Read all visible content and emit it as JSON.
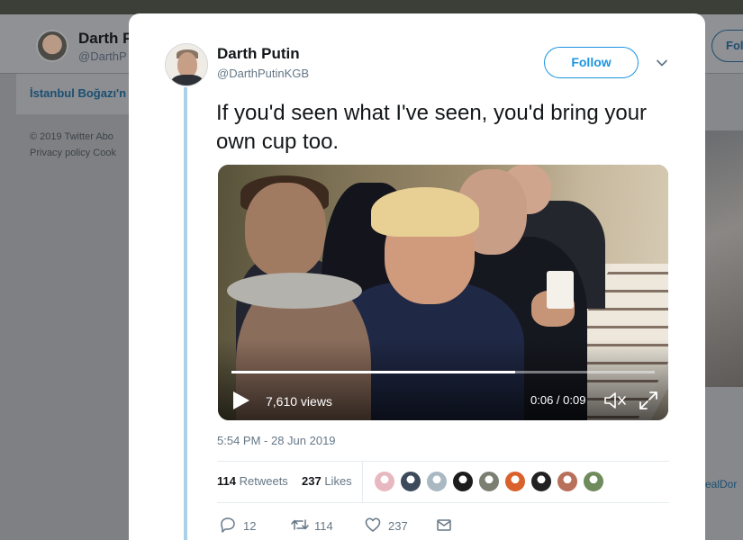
{
  "background": {
    "profile_name": "Darth P",
    "profile_handle": "@DarthP",
    "link_text": "İstanbul Boğazı'n",
    "footer_line1": "© 2019 Twitter   Abo",
    "footer_line2": "Privacy policy   Cook",
    "follow_label": "Fol",
    "right_link": "ealDor"
  },
  "tweet": {
    "author_name": "Darth Putin",
    "author_handle": "@DarthPutinKGB",
    "follow_label": "Follow",
    "text": "If you'd seen what I've seen, you'd bring your own cup too.",
    "timestamp": "5:54 PM - 28 Jun 2019",
    "video": {
      "views": "7,610 views",
      "time": "0:06 / 0:09",
      "progress_fraction": 0.67
    },
    "stats": {
      "retweets_count": "114",
      "retweets_label": "Retweets",
      "likes_count": "237",
      "likes_label": "Likes"
    },
    "liker_avatars": [
      {
        "name": "liker-1",
        "color": "#e8b8c0"
      },
      {
        "name": "liker-2",
        "color": "#3d4a5c"
      },
      {
        "name": "liker-3",
        "color": "#aab8c2"
      },
      {
        "name": "liker-4",
        "color": "#1c1c1c"
      },
      {
        "name": "liker-5",
        "color": "#7a7f72"
      },
      {
        "name": "liker-6",
        "color": "#d9612b"
      },
      {
        "name": "liker-7",
        "color": "#222222"
      },
      {
        "name": "liker-8",
        "color": "#b8705a"
      },
      {
        "name": "liker-9",
        "color": "#6f8a5b"
      }
    ],
    "actions": {
      "reply_count": "12",
      "retweet_count": "114",
      "like_count": "237"
    }
  },
  "colors": {
    "accent": "#1b95e0",
    "thread_line": "#a9d1ea",
    "muted_text": "#657786"
  }
}
